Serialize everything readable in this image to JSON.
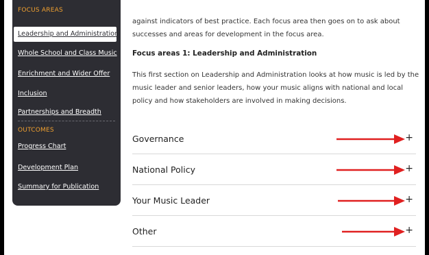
{
  "sidebar": {
    "focus_heading": "FOCUS AREAS",
    "active_item": "Leadership and Administration",
    "items": [
      "Whole School and Class Music",
      "Enrichment and Wider Offer",
      "Inclusion",
      "Partnerships and Breadth"
    ],
    "outcomes_heading": "OUTCOMES",
    "outcome_items": [
      "Progress Chart",
      "Development Plan",
      "Summary for Publication"
    ]
  },
  "content": {
    "intro_text": "against indicators of best practice. Each focus area then goes on to ask about successes and areas for development in the focus area.",
    "section_title": "Focus areas 1: Leadership and Administration",
    "section_text": "This first section on Leadership and Administration looks at how music is led by the music leader and senior leaders, how your music aligns with national and local policy and how stakeholders are involved in making decisions."
  },
  "accordion": [
    {
      "label": "Governance",
      "icon": "plus-icon",
      "expand_symbol": "+"
    },
    {
      "label": "National Policy",
      "icon": "plus-icon",
      "expand_symbol": "+"
    },
    {
      "label": "Your Music Leader",
      "icon": "plus-icon",
      "expand_symbol": "+"
    },
    {
      "label": "Other",
      "icon": "plus-icon",
      "expand_symbol": "+"
    }
  ],
  "colors": {
    "sidebar_bg": "#2d2d33",
    "heading_accent": "#f0a030",
    "annotation_arrow": "#e02020"
  }
}
